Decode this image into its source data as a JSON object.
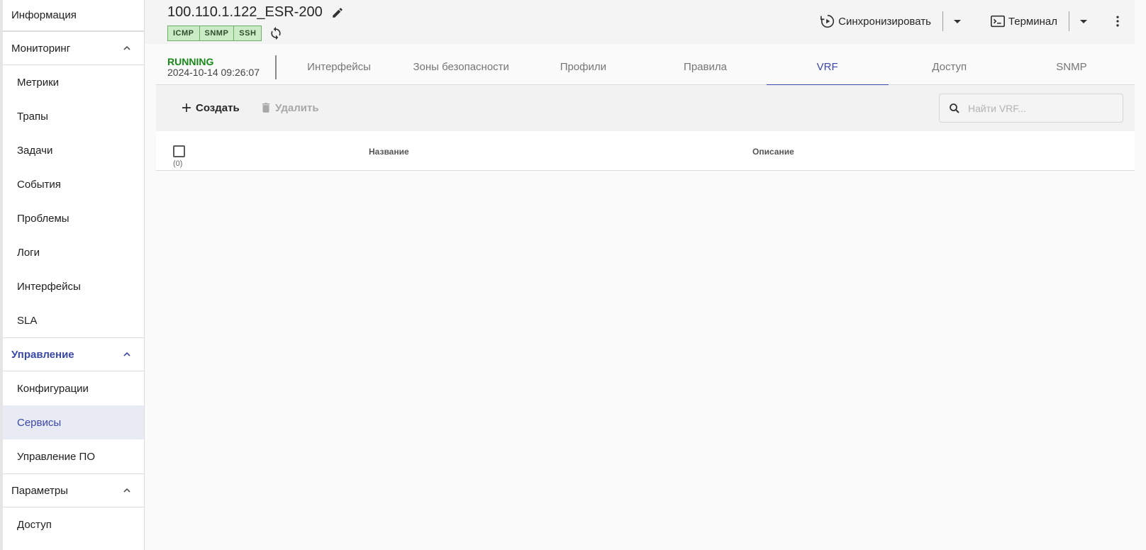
{
  "sidebar": {
    "info": "Информация",
    "monitoring": {
      "label": "Мониторинг",
      "items": [
        "Метрики",
        "Трапы",
        "Задачи",
        "События",
        "Проблемы",
        "Логи",
        "Интерфейсы",
        "SLA"
      ]
    },
    "management": {
      "label": "Управление",
      "items": [
        "Конфигурации",
        "Сервисы",
        "Управление ПО"
      ],
      "selected": "Сервисы"
    },
    "parameters": {
      "label": "Параметры",
      "items": [
        "Доступ"
      ]
    }
  },
  "header": {
    "device_name": "100.110.1.122_ESR-200",
    "protocols": [
      "ICMP",
      "SNMP",
      "SSH"
    ],
    "sync_label": "Синхронизировать",
    "terminal_label": "Терминал"
  },
  "status": {
    "state": "RUNNING",
    "timestamp": "2024-10-14 09:26:07",
    "state_color": "#168a16"
  },
  "tabs": {
    "items": [
      "Интерфейсы",
      "Зоны безопасности",
      "Профили",
      "Правила",
      "VRF",
      "Доступ",
      "SNMP"
    ],
    "active": "VRF"
  },
  "toolbar": {
    "create_label": "Создать",
    "delete_label": "Удалить",
    "search_placeholder": "Найти VRF..."
  },
  "table": {
    "selected_count": "(0)",
    "columns": [
      "Название",
      "Описание"
    ],
    "rows": []
  },
  "colors": {
    "accent": "#3a48a8",
    "running": "#168a16",
    "badge_bg": "#c9ecc4"
  }
}
